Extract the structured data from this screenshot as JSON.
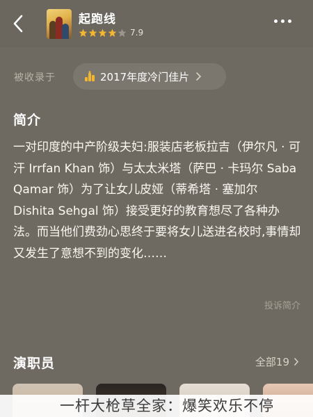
{
  "header": {
    "title": "起跑线",
    "rating": "7.9",
    "stars_filled": 4,
    "stars_total": 5
  },
  "collection": {
    "label": "被收录于",
    "chip_text": "2017年度冷门佳片"
  },
  "intro": {
    "heading": "简介",
    "body": "一对印度的中产阶级夫妇:服装店老板拉吉（伊尔凡 · 可汗 Irrfan Khan 饰）与太太米塔（萨巴 · 卡玛尔 Saba Qamar 饰）为了让女儿皮娅（蒂希塔 · 塞加尔 Dishita Sehgal 饰）接受更好的教育想尽了各种办法。而当他们费劲心思终于要将女儿送进名校时,事情却又发生了意想不到的变化……",
    "report": "投诉简介"
  },
  "cast": {
    "heading": "演职员",
    "all_label": "全部19"
  },
  "caption": "一杆大枪草全家：爆笑欢乐不停",
  "colors": {
    "background": "#6e6a62",
    "star_filled": "#f2b630",
    "star_empty": "#9c968c"
  }
}
